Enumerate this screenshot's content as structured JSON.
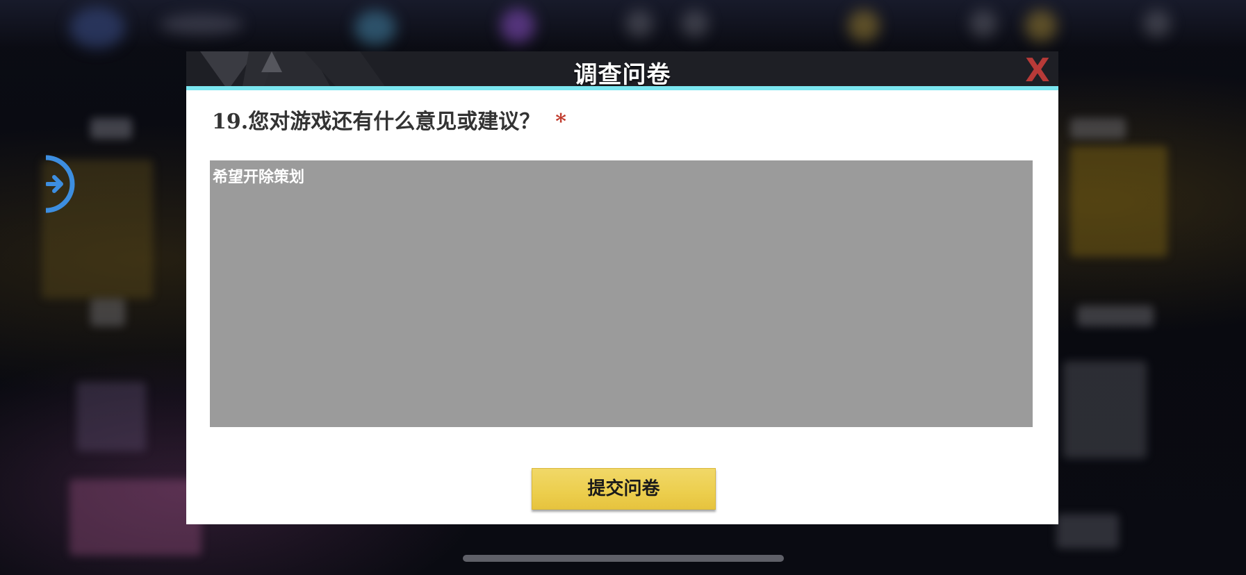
{
  "dialog": {
    "title": "调查问卷",
    "close_label": "X",
    "question": "19.您对游戏还有什么意见或建议？",
    "required_mark": "*",
    "answer": "希望开除策划",
    "submit_label": "提交问卷"
  },
  "colors": {
    "header_bg": "#1e1f25",
    "header_accent": "#7be6f0",
    "close": "#b73a38",
    "required": "#c0392b",
    "answer_bg": "#9b9b9b",
    "submit_bg": "#ecce4d"
  },
  "icons": {
    "side_arrow": "arrow-right-circle-icon",
    "close": "close-icon"
  }
}
